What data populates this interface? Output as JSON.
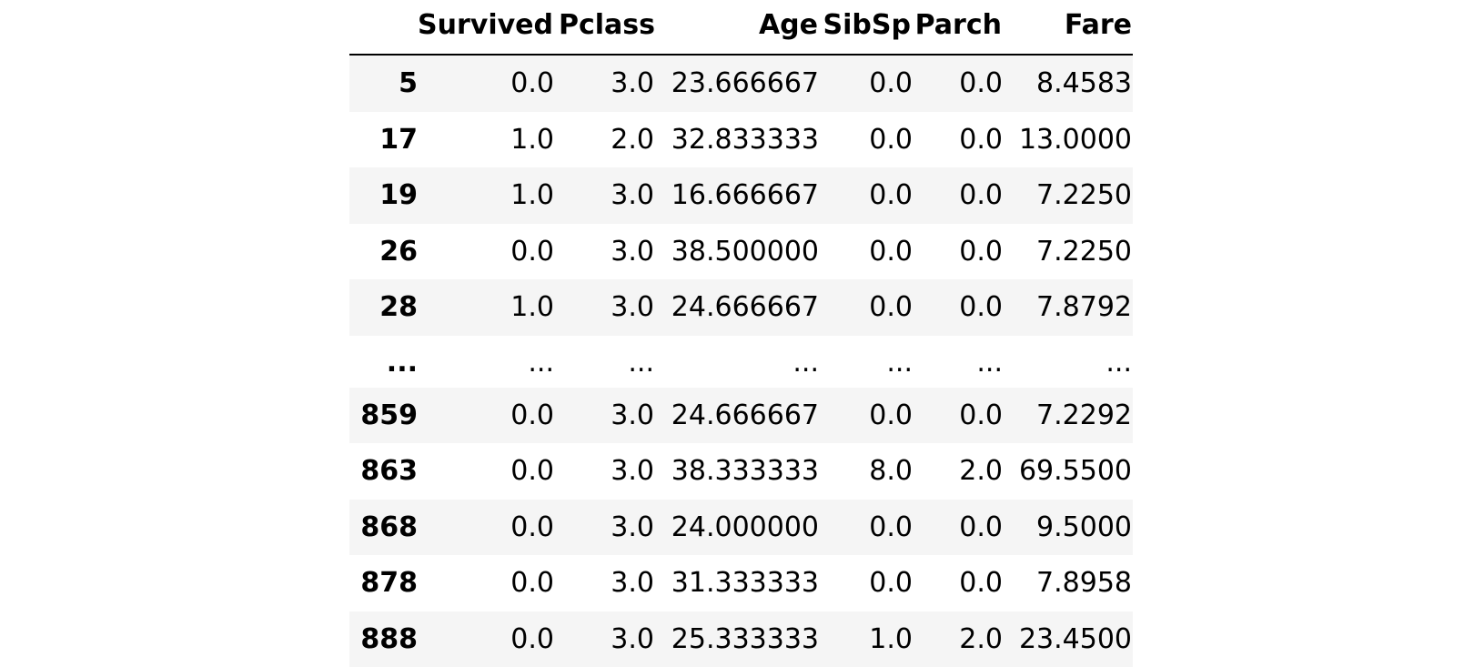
{
  "table": {
    "columns": [
      "",
      "Survived",
      "Pclass",
      "Age",
      "SibSp",
      "Parch",
      "Fare"
    ],
    "rows": [
      {
        "index": "5",
        "cells": [
          "0.0",
          "3.0",
          "23.666667",
          "0.0",
          "0.0",
          "8.4583"
        ]
      },
      {
        "index": "17",
        "cells": [
          "1.0",
          "2.0",
          "32.833333",
          "0.0",
          "0.0",
          "13.0000"
        ]
      },
      {
        "index": "19",
        "cells": [
          "1.0",
          "3.0",
          "16.666667",
          "0.0",
          "0.0",
          "7.2250"
        ]
      },
      {
        "index": "26",
        "cells": [
          "0.0",
          "3.0",
          "38.500000",
          "0.0",
          "0.0",
          "7.2250"
        ]
      },
      {
        "index": "28",
        "cells": [
          "1.0",
          "3.0",
          "24.666667",
          "0.0",
          "0.0",
          "7.8792"
        ]
      },
      {
        "index": "...",
        "cells": [
          "...",
          "...",
          "...",
          "...",
          "...",
          "..."
        ]
      },
      {
        "index": "859",
        "cells": [
          "0.0",
          "3.0",
          "24.666667",
          "0.0",
          "0.0",
          "7.2292"
        ]
      },
      {
        "index": "863",
        "cells": [
          "0.0",
          "3.0",
          "38.333333",
          "8.0",
          "2.0",
          "69.5500"
        ]
      },
      {
        "index": "868",
        "cells": [
          "0.0",
          "3.0",
          "24.000000",
          "0.0",
          "0.0",
          "9.5000"
        ]
      },
      {
        "index": "878",
        "cells": [
          "0.0",
          "3.0",
          "31.333333",
          "0.0",
          "0.0",
          "7.8958"
        ]
      },
      {
        "index": "888",
        "cells": [
          "0.0",
          "3.0",
          "25.333333",
          "1.0",
          "2.0",
          "23.4500"
        ]
      }
    ],
    "stripe_color": "#f5f5f5"
  }
}
